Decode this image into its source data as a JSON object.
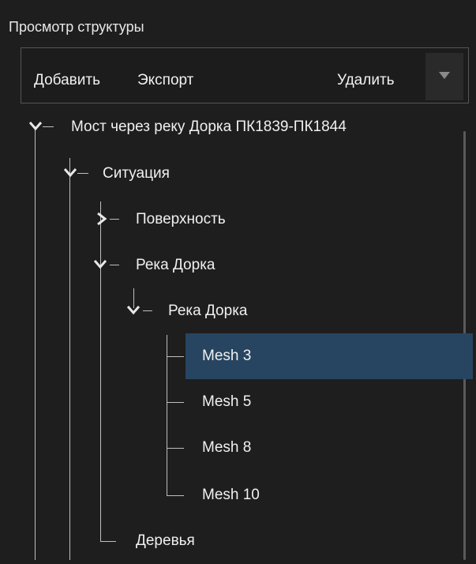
{
  "panel": {
    "title": "Просмотр структуры"
  },
  "toolbar": {
    "add_label": "Добавить",
    "export_label": "Экспорт",
    "delete_label": "Удалить",
    "dropdown_icon": "triangle-down-icon"
  },
  "colors": {
    "background": "#1e1e1e",
    "selection": "#274560",
    "text": "#f0f0f0",
    "tree_lines": "#bfbfbf"
  },
  "tree": {
    "root": {
      "label": "Мост через реку Дорка ПК1839-ПК1844",
      "expanded": true
    },
    "situation": {
      "label": "Ситуация",
      "expanded": true
    },
    "surface": {
      "label": "Поверхность",
      "expanded": false
    },
    "river": {
      "label": "Река Дорка",
      "expanded": true
    },
    "river_child": {
      "label": "Река Дорка",
      "expanded": true
    },
    "mesh3": {
      "label": "Mesh 3",
      "selected": true
    },
    "mesh5": {
      "label": "Mesh 5"
    },
    "mesh8": {
      "label": "Mesh 8"
    },
    "mesh10": {
      "label": "Mesh 10"
    },
    "trees": {
      "label": "Деревья"
    }
  }
}
